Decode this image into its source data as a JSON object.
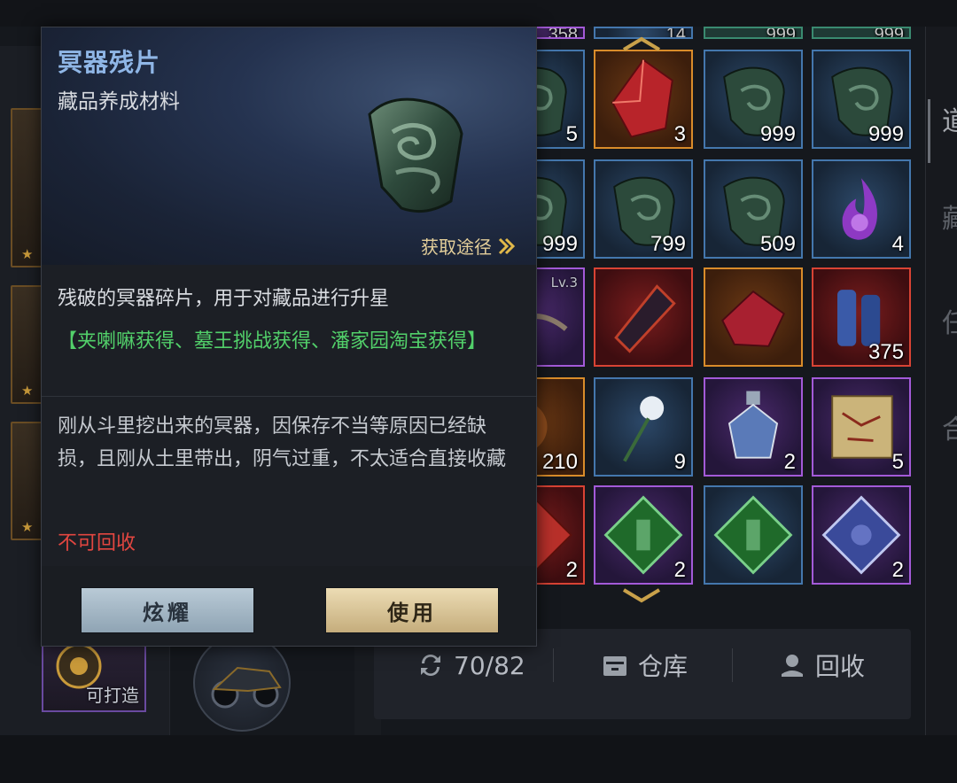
{
  "tooltip": {
    "title": "冥器残片",
    "subtitle": "藏品养成材料",
    "source_label": "获取途径",
    "description": "残破的冥器碎片，用于对藏品进行升星",
    "obtain_methods": "【夹喇嘛获得、墓王挑战获得、潘家园淘宝获得】",
    "lore": "刚从斗里挖出来的冥器，因保存不当等原因已经缺损，且刚从土里带出，阴气过重，不太适合直接收藏",
    "recycle_status": "不可回收",
    "buttons": {
      "show_off": "炫耀",
      "use": "使用"
    },
    "title_color": "#8fb6e6",
    "obtain_color": "#52d06a",
    "recycle_color": "#e24640"
  },
  "inventory": {
    "top_row_counts": [
      "358",
      "14",
      "999",
      "999"
    ],
    "rows": [
      [
        {
          "count": "5",
          "quality": "blue",
          "icon": "jade-fragment-icon"
        },
        {
          "count": "3",
          "quality": "orange",
          "icon": "red-crystal-icon"
        },
        {
          "count": "999",
          "quality": "blue",
          "icon": "jade-fragment-icon"
        },
        {
          "count": "999",
          "quality": "blue",
          "icon": "jade-fragment-icon"
        }
      ],
      [
        {
          "count": "999",
          "quality": "blue",
          "icon": "jade-fragment-icon"
        },
        {
          "count": "799",
          "quality": "blue",
          "icon": "jade-fragment-icon"
        },
        {
          "count": "509",
          "quality": "blue",
          "icon": "jade-fragment-icon"
        },
        {
          "count": "4",
          "quality": "blue",
          "icon": "purple-flame-icon"
        }
      ],
      [
        {
          "count": "",
          "level": "Lv.3",
          "quality": "purple",
          "icon": "talisman-icon"
        },
        {
          "count": "",
          "quality": "red",
          "icon": "dark-blade-icon"
        },
        {
          "count": "",
          "quality": "orange",
          "icon": "red-cape-icon"
        },
        {
          "count": "375",
          "quality": "red",
          "icon": "scroll-bundle-icon"
        }
      ],
      [
        {
          "count": "210",
          "quality": "orange",
          "icon": "bronze-orb-icon"
        },
        {
          "count": "9",
          "quality": "blue",
          "icon": "white-flower-icon"
        },
        {
          "count": "2",
          "quality": "purple",
          "icon": "potion-bottle-icon"
        },
        {
          "count": "5",
          "quality": "purple",
          "icon": "treasure-map-icon"
        }
      ],
      [
        {
          "count": "2",
          "quality": "red",
          "icon": "red-gem-icon"
        },
        {
          "count": "2",
          "quality": "purple",
          "icon": "green-gem-icon"
        },
        {
          "count": "",
          "quality": "blue",
          "icon": "green-gem-icon"
        },
        {
          "count": "2",
          "quality": "purple",
          "icon": "blue-gem-icon"
        }
      ]
    ]
  },
  "bottom_bar": {
    "capacity": "70/82",
    "warehouse": "仓库",
    "recycle": "回收"
  },
  "left_panel": {
    "craft_label": "可打造"
  },
  "right_tabs": [
    "道",
    "藏",
    "任",
    "合"
  ]
}
